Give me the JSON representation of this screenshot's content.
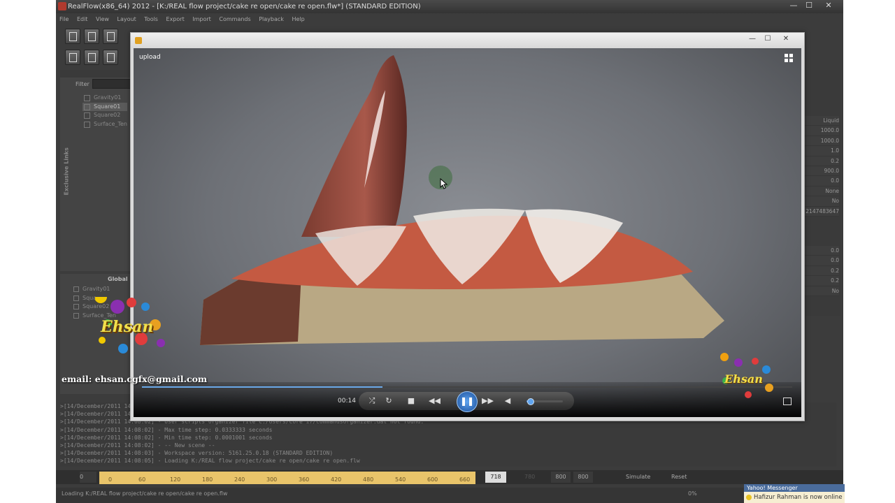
{
  "app": {
    "title": "RealFlow(x86_64) 2012 - [K:/REAL flow project/cake re open/cake re open.flw*] (STANDARD EDITION)",
    "window_controls": [
      "—",
      "☐",
      "✕"
    ],
    "menu": [
      "File",
      "Edit",
      "View",
      "Layout",
      "Tools",
      "Export",
      "Import",
      "Commands",
      "Playback",
      "Help"
    ]
  },
  "nodes_panel": {
    "filter_label": "Filter",
    "items": [
      "Gravity01",
      "Square01",
      "Square02",
      "Surface_Ten"
    ],
    "selected_index": 1,
    "vertical_label": "Exclusive Links"
  },
  "global_panel": {
    "title": "Global",
    "items": [
      "Gravity01",
      "Squa",
      "Square02",
      "Surface_Ten"
    ]
  },
  "properties": {
    "values_top": [
      "Liquid",
      "1000.0",
      "1000.0",
      "1.0",
      "0.2",
      "900.0",
      "0.0",
      "None",
      "No",
      "2147483647"
    ],
    "values_bottom": [
      "0.0",
      "0.0",
      "0.2",
      "0.2",
      "No"
    ]
  },
  "console": {
    "lines": [
      ">[14/December/2011 14:",
      ">[14/December/2011 14:",
      ">[14/December/2011 14:08:02] - User scripts organizer file C:/Users/Core i7/commandsOrganizer.dat not found.",
      ">[14/December/2011 14:08:02] - Max time step: 0.0333333 seconds",
      ">[14/December/2011 14:08:02] - Min time step: 0.0001001 seconds",
      ">[14/December/2011 14:08:02] - -- New scene --",
      ">[14/December/2011 14:08:03] - Workspace version: 5161.25.0.18 (STANDARD EDITION)",
      ">[14/December/2011 14:08:05] - Loading K:/REAL flow project/cake re open/cake re open.flw"
    ]
  },
  "timeline": {
    "start": "0",
    "ticks": [
      "0",
      "60",
      "120",
      "180",
      "240",
      "300",
      "360",
      "420",
      "480",
      "540",
      "600",
      "660"
    ],
    "current_frame": "718",
    "faded_label": "780",
    "end_a": "800",
    "end_b": "800",
    "simulate": "Simulate",
    "reset": "Reset"
  },
  "status": {
    "text": "Loading K:/REAL flow project/cake re open/cake re open.flw",
    "percent": "0%"
  },
  "notification": {
    "header": "Yahoo! Messenger",
    "body": "Hafizur Rahman is now online"
  },
  "player": {
    "label": "upload",
    "time": "00:14",
    "seek_fraction": 0.37,
    "volume_fraction": 0.05
  },
  "watermark": {
    "email": "email:  ehsan.cgfx@gmail.com",
    "logo_text": "Ehsan",
    "logo_small_text": "Ehsan"
  }
}
